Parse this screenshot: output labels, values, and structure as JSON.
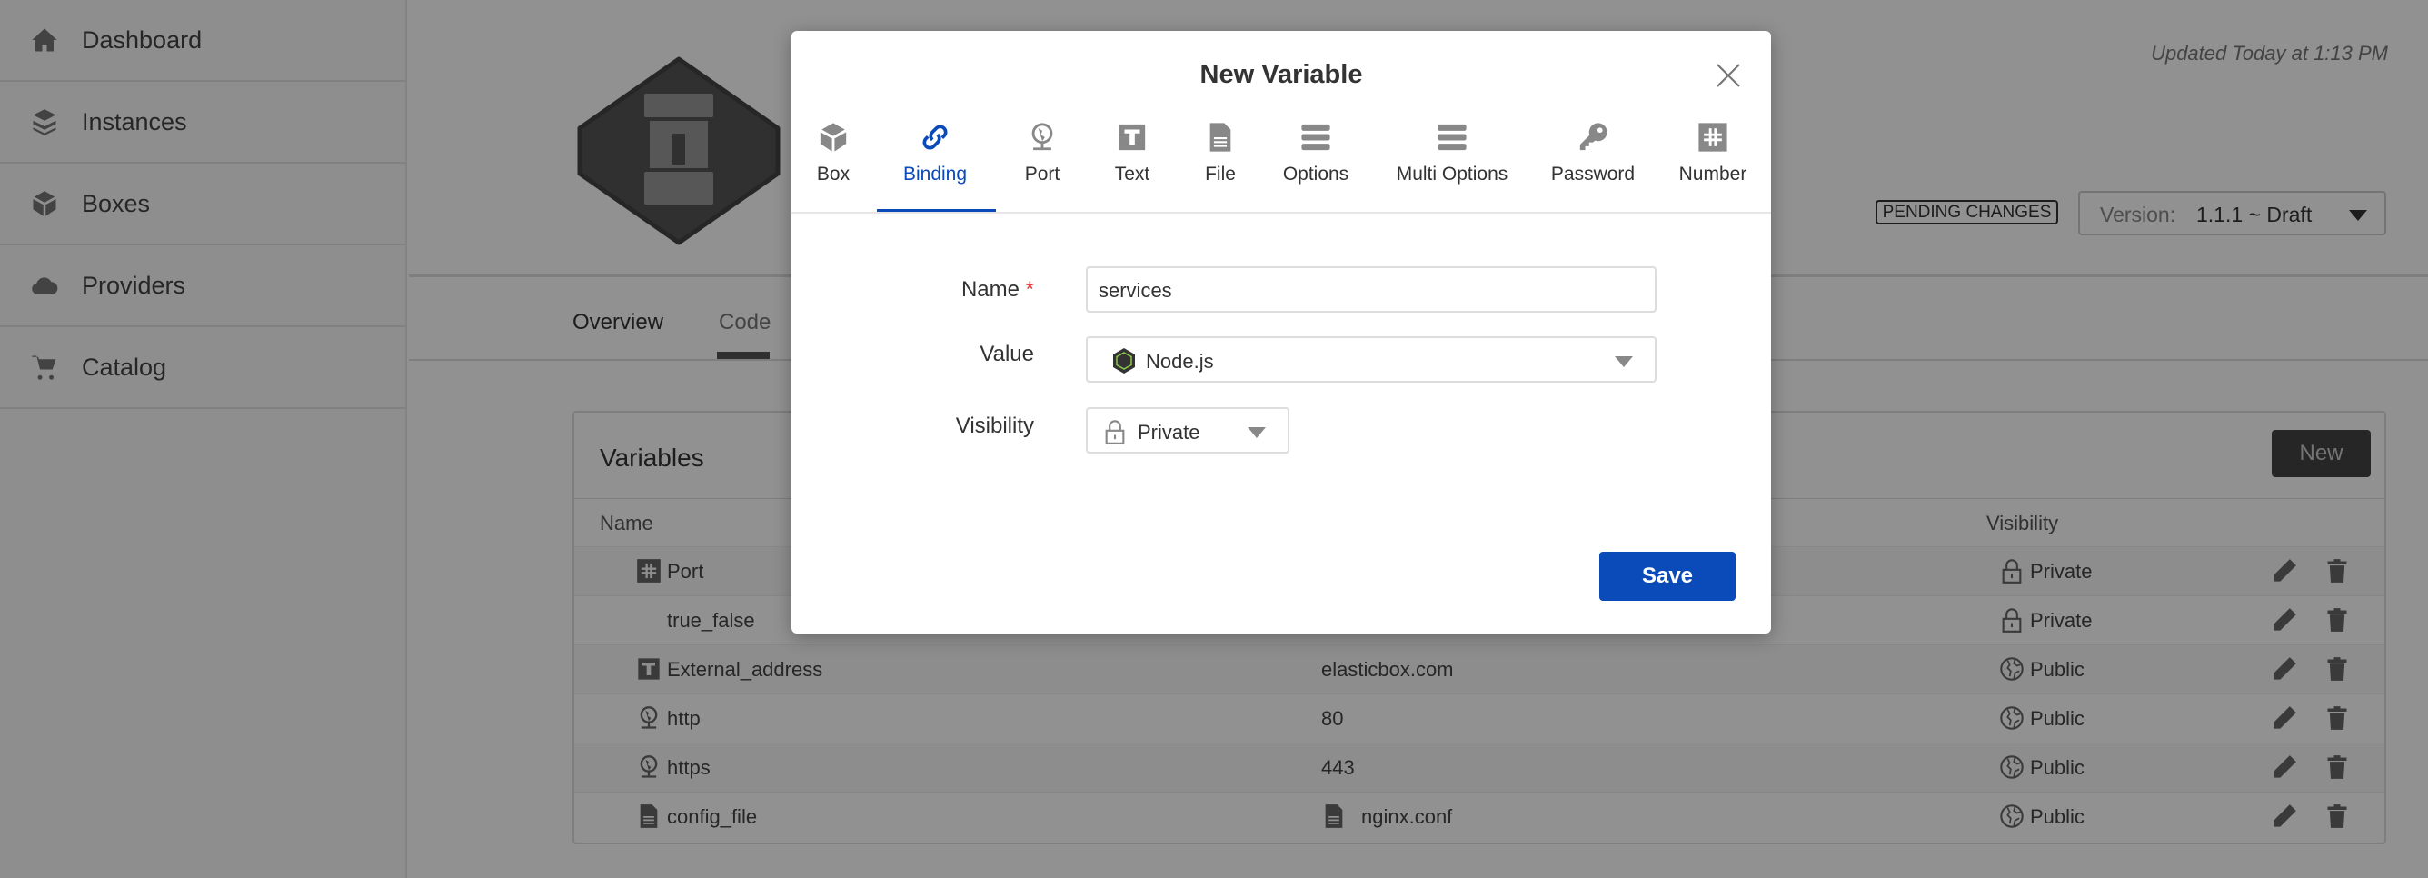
{
  "sidebar": {
    "items": [
      {
        "label": "Dashboard",
        "icon": "home-icon"
      },
      {
        "label": "Instances",
        "icon": "layers-icon"
      },
      {
        "label": "Boxes",
        "icon": "box-icon"
      },
      {
        "label": "Providers",
        "icon": "cloud-icon"
      },
      {
        "label": "Catalog",
        "icon": "cart-icon"
      }
    ]
  },
  "header": {
    "updated": "Updated Today at 1:13 PM",
    "pending": "PENDING CHANGES",
    "version_label": "Version:",
    "version_value": "1.1.1 ~ Draft"
  },
  "page_tabs": [
    {
      "label": "Overview"
    },
    {
      "label": "Code",
      "active": true
    }
  ],
  "variables": {
    "title": "Variables",
    "new_label": "New",
    "columns": {
      "name": "Name",
      "visibility": "Visibility"
    },
    "rows": [
      {
        "icon": "number-icon",
        "name": "Port",
        "value": "",
        "visibility": "Private"
      },
      {
        "icon": "link-icon",
        "name": "true_false",
        "value": "",
        "visibility": "Private"
      },
      {
        "icon": "text-icon",
        "name": "External_address",
        "value": "elasticbox.com",
        "visibility": "Public"
      },
      {
        "icon": "port-icon",
        "name": "http",
        "value": "80",
        "visibility": "Public"
      },
      {
        "icon": "port-icon",
        "name": "https",
        "value": "443",
        "visibility": "Public"
      },
      {
        "icon": "file-icon",
        "name": "config_file",
        "value": "nginx.conf",
        "value_icon": "file-icon",
        "visibility": "Public"
      }
    ]
  },
  "modal": {
    "title": "New Variable",
    "tabs": [
      {
        "label": "Box"
      },
      {
        "label": "Binding",
        "active": true
      },
      {
        "label": "Port"
      },
      {
        "label": "Text"
      },
      {
        "label": "File"
      },
      {
        "label": "Options"
      },
      {
        "label": "Multi Options"
      },
      {
        "label": "Password"
      },
      {
        "label": "Number"
      }
    ],
    "name_label": "Name",
    "required_mark": "*",
    "name_value": "services",
    "value_label": "Value",
    "value_selected": "Node.js",
    "visibility_label": "Visibility",
    "visibility_selected": "Private",
    "save_label": "Save"
  },
  "colors": {
    "accent": "#0b4bb9",
    "required": "#e53935",
    "overlay": "rgba(0,0,0,0.43)"
  }
}
